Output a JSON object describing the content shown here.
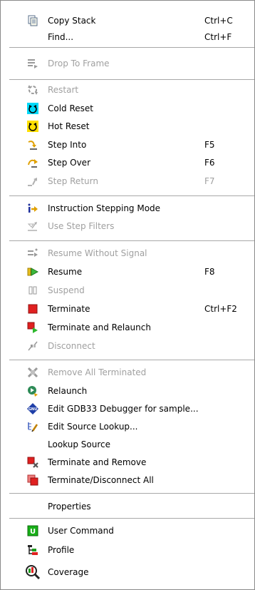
{
  "menu": {
    "copy_stack": {
      "label": "Copy Stack",
      "shortcut": "Ctrl+C",
      "icon": "copy-icon"
    },
    "find": {
      "label": "Find...",
      "shortcut": "Ctrl+F"
    },
    "drop_to_frame": {
      "label": "Drop To Frame",
      "icon": "drop-to-frame-icon"
    },
    "restart": {
      "label": "Restart",
      "icon": "restart-icon"
    },
    "cold_reset": {
      "label": "Cold Reset",
      "icon": "cold-reset-icon"
    },
    "hot_reset": {
      "label": "Hot Reset",
      "icon": "hot-reset-icon"
    },
    "step_into": {
      "label": "Step Into",
      "shortcut": "F5",
      "icon": "step-into-icon"
    },
    "step_over": {
      "label": "Step Over",
      "shortcut": "F6",
      "icon": "step-over-icon"
    },
    "step_return": {
      "label": "Step Return",
      "shortcut": "F7",
      "icon": "step-return-icon"
    },
    "instruction_stepping": {
      "label": "Instruction Stepping Mode",
      "icon": "instruction-stepping-icon"
    },
    "use_step_filters": {
      "label": "Use Step Filters",
      "icon": "step-filters-icon"
    },
    "resume_without_signal": {
      "label": "Resume Without Signal",
      "icon": "resume-without-signal-icon"
    },
    "resume": {
      "label": "Resume",
      "shortcut": "F8",
      "icon": "resume-icon"
    },
    "suspend": {
      "label": "Suspend",
      "icon": "suspend-icon"
    },
    "terminate": {
      "label": "Terminate",
      "shortcut": "Ctrl+F2",
      "icon": "terminate-icon"
    },
    "terminate_relaunch": {
      "label": "Terminate and Relaunch",
      "icon": "terminate-relaunch-icon"
    },
    "disconnect": {
      "label": "Disconnect",
      "icon": "disconnect-icon"
    },
    "remove_all_terminated": {
      "label": "Remove All Terminated",
      "icon": "remove-all-icon"
    },
    "relaunch": {
      "label": "Relaunch",
      "icon": "relaunch-icon"
    },
    "edit_gdb": {
      "label": "Edit GDB33 Debugger for sample...",
      "icon": "gnu-icon",
      "icon_text": "GNU"
    },
    "edit_source_lookup": {
      "label": "Edit Source Lookup...",
      "icon": "edit-source-lookup-icon"
    },
    "lookup_source": {
      "label": "Lookup Source"
    },
    "terminate_remove": {
      "label": "Terminate and Remove",
      "icon": "terminate-remove-icon"
    },
    "terminate_disconnect_all": {
      "label": "Terminate/Disconnect All",
      "icon": "terminate-all-icon"
    },
    "properties": {
      "label": "Properties"
    },
    "user_command": {
      "label": "User Command",
      "icon": "user-command-icon",
      "icon_text": "U"
    },
    "profile": {
      "label": "Profile",
      "icon": "profile-icon"
    },
    "coverage": {
      "label": "Coverage",
      "icon": "coverage-icon"
    }
  }
}
